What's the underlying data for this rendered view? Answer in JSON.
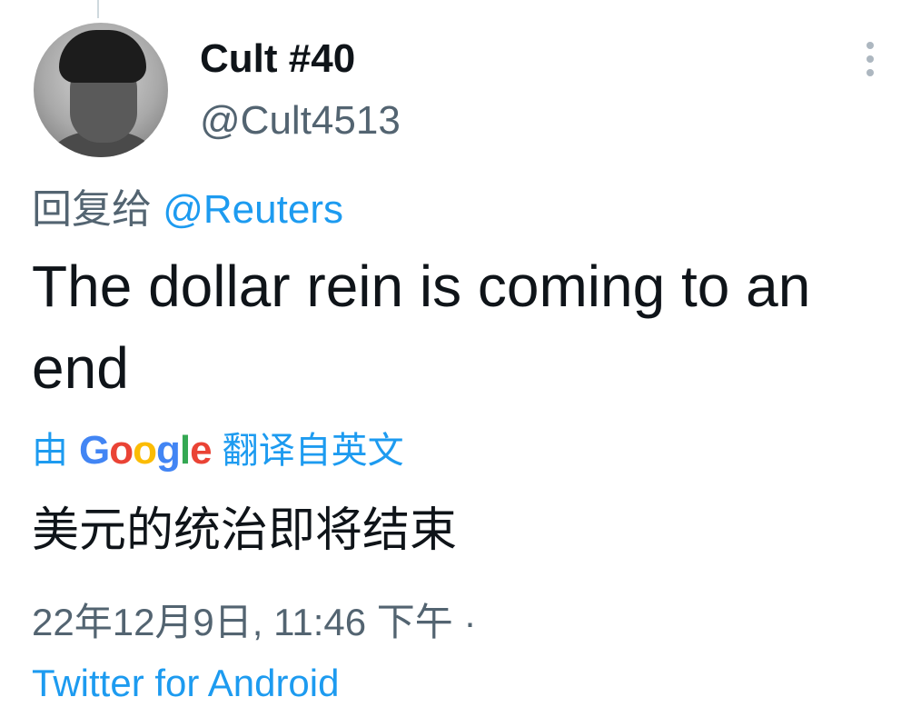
{
  "tweet": {
    "display_name": "Cult #40",
    "handle": "@Cult4513",
    "reply_prefix": "回复给",
    "reply_to": "@Reuters",
    "text": "The dollar rein is coming to an end",
    "translated_prefix": "由",
    "translator_brand_letters": [
      "G",
      "o",
      "o",
      "g",
      "l",
      "e"
    ],
    "translated_suffix": "翻译自英文",
    "translation": "美元的统治即将结束",
    "timestamp": "22年12月9日, 11:46 下午 ·",
    "source": "Twitter for Android"
  },
  "icons": {
    "avatar": "profile-photo",
    "more": "more-vertical-icon"
  },
  "colors": {
    "text_primary": "#0f1419",
    "text_secondary": "#536471",
    "link": "#1d9bf0",
    "google_blue": "#4285f4",
    "google_red": "#ea4335",
    "google_yellow": "#fbbc05",
    "google_green": "#34a853"
  }
}
